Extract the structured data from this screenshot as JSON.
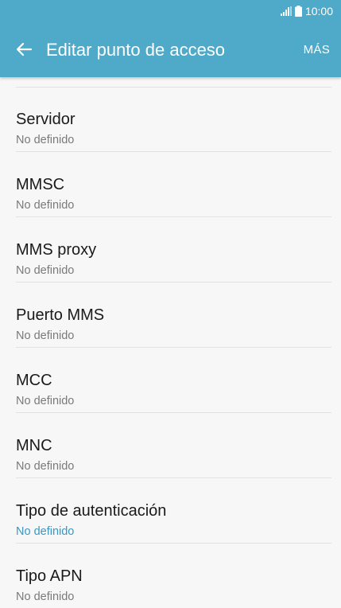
{
  "status_bar": {
    "time": "10:00",
    "icons": [
      "signal-icon",
      "battery-icon"
    ]
  },
  "app_bar": {
    "back_icon": "arrow-left-icon",
    "title": "Editar punto de acceso",
    "more_label": "MÁS"
  },
  "colors": {
    "app_bar_background": "#4fa9c9",
    "accent_text": "#3a97c3",
    "primary_text": "#1a1a1a",
    "secondary_text": "#7a7a7a",
    "background": "#f7f7f7"
  },
  "items": [
    {
      "title": "Servidor",
      "value": "No definido"
    },
    {
      "title": "MMSC",
      "value": "No definido"
    },
    {
      "title": "MMS proxy",
      "value": "No definido"
    },
    {
      "title": "Puerto MMS",
      "value": "No definido"
    },
    {
      "title": "MCC",
      "value": "No definido"
    },
    {
      "title": "MNC",
      "value": "No definido"
    },
    {
      "title": "Tipo de autenticación",
      "value": "No definido"
    },
    {
      "title": "Tipo APN",
      "value": "No definido"
    }
  ]
}
